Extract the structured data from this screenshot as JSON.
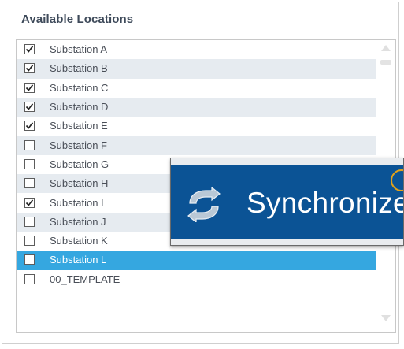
{
  "panel": {
    "title": "Available Locations"
  },
  "locations": [
    {
      "label": "Substation A",
      "checked": true
    },
    {
      "label": "Substation B",
      "checked": true
    },
    {
      "label": "Substation C",
      "checked": true
    },
    {
      "label": "Substation D",
      "checked": true
    },
    {
      "label": "Substation E",
      "checked": true
    },
    {
      "label": "Substation F",
      "checked": false
    },
    {
      "label": "Substation G",
      "checked": false
    },
    {
      "label": "Substation H",
      "checked": false
    },
    {
      "label": "Substation I",
      "checked": true
    },
    {
      "label": "Substation J",
      "checked": false
    },
    {
      "label": "Substation K",
      "checked": false
    },
    {
      "label": "Substation L",
      "checked": false,
      "selected": true
    },
    {
      "label": "00_TEMPLATE",
      "checked": false
    }
  ],
  "sync_button": {
    "label": "Synchronize",
    "icon": "sync-arrows-icon",
    "badge_icon": "info-badge-icon"
  },
  "colors": {
    "row_alt": "#e6ebf0",
    "row_selected": "#35a7e0",
    "sync_button_bg": "#0b5395",
    "badge": "#e3a21a"
  }
}
